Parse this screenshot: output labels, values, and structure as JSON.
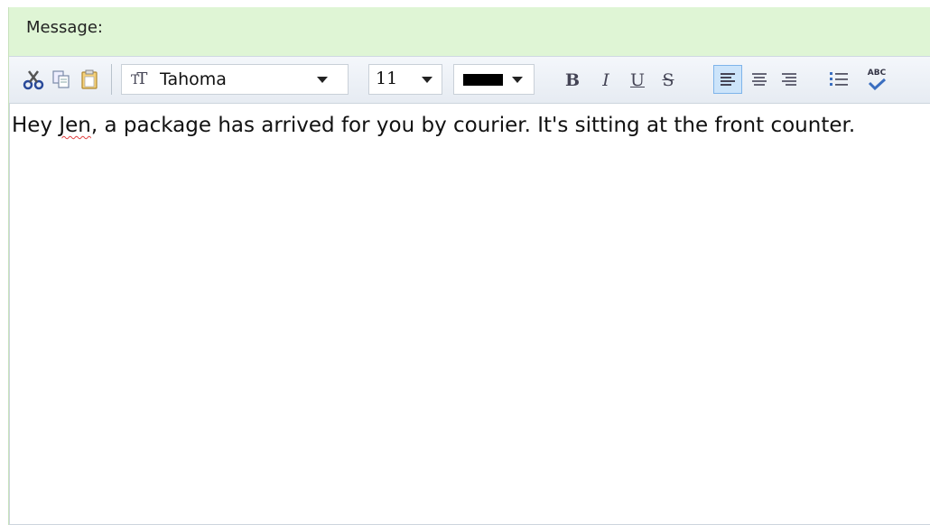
{
  "header": {
    "label": "Message:"
  },
  "toolbar": {
    "cut_icon": "scissors-icon",
    "copy_icon": "copy-icon",
    "paste_icon": "paste-icon",
    "font_family": "Tahoma",
    "font_size": "11",
    "text_color": "#000000",
    "bold": "B",
    "italic": "I",
    "underline": "U",
    "strikethrough": "S",
    "align_left_active": true,
    "spellcheck_label": "ABC"
  },
  "editor": {
    "text_before": "Hey ",
    "misspelled": "Jen",
    "text_after": ", a package has arrived for you by courier.  It's sitting at the front counter."
  }
}
